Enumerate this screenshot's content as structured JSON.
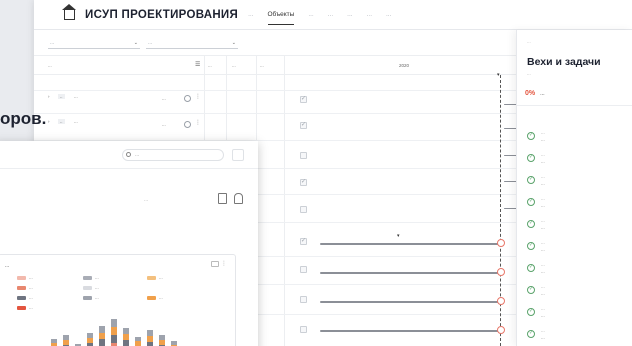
{
  "app": {
    "brand": "ИСУП ПРОЕКТИРОВАНИЯ",
    "tabs": [
      {
        "label": "...",
        "active": false
      },
      {
        "label": "Объекты",
        "active": true
      },
      {
        "label": "...",
        "active": false
      },
      {
        "label": "...",
        "active": false
      },
      {
        "label": "...",
        "active": false
      },
      {
        "label": "...",
        "active": false
      },
      {
        "label": "...",
        "active": false
      }
    ]
  },
  "filters": [
    {
      "value": "..."
    },
    {
      "value": "..."
    }
  ],
  "table": {
    "headers": [
      "...",
      "...",
      "...",
      "...",
      "2020"
    ],
    "rows": [
      {
        "name": "...",
        "value": "..."
      },
      {
        "name": "...",
        "value": "..."
      }
    ]
  },
  "panel": {
    "top_label": "...",
    "title": "Вехи и задачи",
    "subtitle": "...",
    "progress_pct": "0%",
    "progress_label": "...",
    "milestones": [
      {
        "title": "...",
        "date": "..."
      },
      {
        "title": "...",
        "date": "..."
      },
      {
        "title": "...",
        "date": "..."
      },
      {
        "title": "...",
        "date": "..."
      },
      {
        "title": "...",
        "date": "..."
      },
      {
        "title": "...",
        "date": "..."
      },
      {
        "title": "...",
        "date": "..."
      },
      {
        "title": "...",
        "date": "..."
      },
      {
        "title": "...",
        "date": "..."
      },
      {
        "title": "...",
        "date": "..."
      },
      {
        "title": "...",
        "date": "..."
      }
    ]
  },
  "headline": "оров.",
  "front": {
    "search_placeholder": "...",
    "subtitle": "...",
    "chart_title": "...",
    "legend": [
      {
        "label": "...",
        "color": "#f2b9ad"
      },
      {
        "label": "...",
        "color": "#a9adb6"
      },
      {
        "label": "...",
        "color": "#f3c07f"
      },
      {
        "label": "...",
        "color": "#e8876f"
      },
      {
        "label": "...",
        "color": "#d9dbe0"
      },
      {
        "label": "...",
        "color": "#6f7480"
      },
      {
        "label": "...",
        "color": "#9ea3ad"
      },
      {
        "label": "...",
        "color": "#f0a04b"
      },
      {
        "label": "...",
        "color": "#e3553f"
      }
    ],
    "bar_colors": [
      "#f2b9ad",
      "#e8876f",
      "#6f7480",
      "#f0a04b",
      "#9ea3ad"
    ],
    "bar_levels": [
      0.25,
      0.45,
      0.55,
      0.35,
      0.6,
      0.75,
      0.9,
      0.7,
      0.5,
      0.65,
      0.55,
      0.4
    ]
  }
}
